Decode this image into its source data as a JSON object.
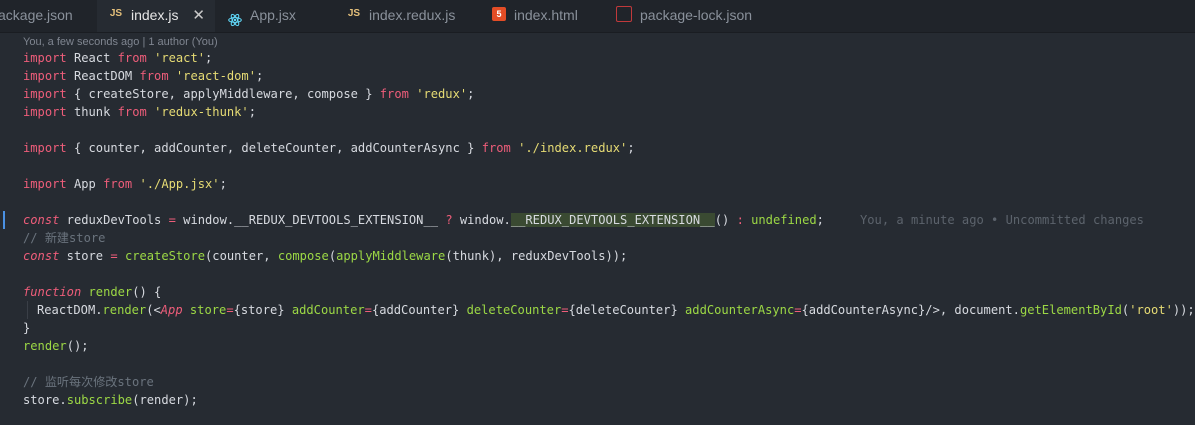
{
  "tabs": [
    {
      "label": "ackage.json",
      "icon": "json-file-icon",
      "active": false
    },
    {
      "label": "index.js",
      "icon": "js-file-icon",
      "active": true,
      "close": "✕"
    },
    {
      "label": "App.jsx",
      "icon": "react-icon",
      "active": false
    },
    {
      "label": "index.redux.js",
      "icon": "js-file-icon",
      "active": false
    },
    {
      "label": "index.html",
      "icon": "html5-icon",
      "active": false
    },
    {
      "label": "package-lock.json",
      "icon": "npm-icon",
      "active": false
    }
  ],
  "icon_text": {
    "js": "JS",
    "html": "5"
  },
  "blame_header": "You, a few seconds ago | 1 author (You)",
  "inline_blame": "You, a minute ago • Uncommitted changes",
  "code": {
    "l1": [
      "import",
      " React ",
      "from",
      " ",
      "'react'",
      ";"
    ],
    "l2": [
      "import",
      " ReactDOM ",
      "from",
      " ",
      "'react-dom'",
      ";"
    ],
    "l3": [
      "import",
      " { createStore, applyMiddleware, compose } ",
      "from",
      " ",
      "'redux'",
      ";"
    ],
    "l4": [
      "import",
      " thunk ",
      "from",
      " ",
      "'redux-thunk'",
      ";"
    ],
    "l6": [
      "import",
      " { counter, addCounter, deleteCounter, addCounterAsync } ",
      "from",
      " ",
      "'./index.redux'",
      ";"
    ],
    "l8": [
      "import",
      " App ",
      "from",
      " ",
      "'./App.jsx'",
      ";"
    ],
    "l10": [
      "const",
      " reduxDevTools ",
      "=",
      " window.__REDUX_DEVTOOLS_EXTENSION__ ",
      "?",
      " window.",
      "__REDUX_DEVTOOLS_EXTENSION__",
      "() ",
      ":",
      " ",
      "undefined",
      ";"
    ],
    "l11": "// 新建store",
    "l12": [
      "const",
      " store ",
      "=",
      " ",
      "createStore",
      "(counter, ",
      "compose",
      "(",
      "applyMiddleware",
      "(thunk), reduxDevTools));"
    ],
    "l14": [
      "function",
      " ",
      "render",
      "() {"
    ],
    "l15": [
      "ReactDOM.",
      "render",
      "(<",
      "App",
      " ",
      "store",
      "=",
      "{store} ",
      "addCounter",
      "=",
      "{addCounter} ",
      "deleteCounter",
      "=",
      "{deleteCounter} ",
      "addCounterAsync",
      "=",
      "{addCounterAsync}/>, document.",
      "getElementById",
      "(",
      "'root'",
      "));"
    ],
    "l16": "}",
    "l17": [
      "render",
      "();"
    ],
    "l19": "// 监听每次修改store",
    "l20": [
      "store.",
      "subscribe",
      "(render);"
    ]
  }
}
